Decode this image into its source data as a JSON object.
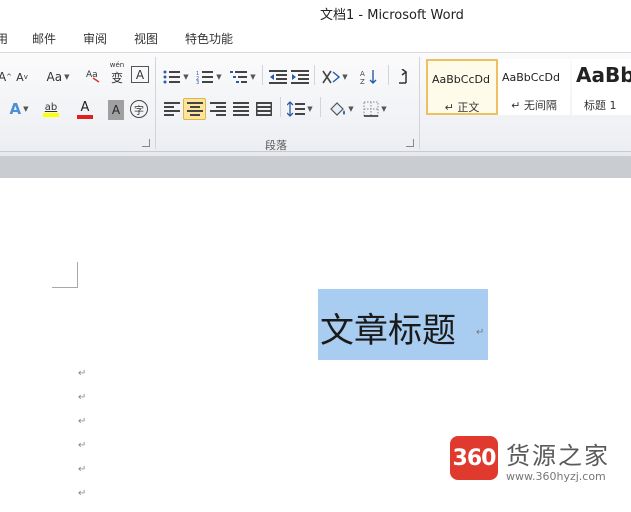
{
  "window": {
    "title": "文档1 - Microsoft Word"
  },
  "menu": {
    "tabs": [
      "用",
      "邮件",
      "审阅",
      "视图",
      "特色功能"
    ]
  },
  "ribbon": {
    "font_group": {
      "grow_font": "A",
      "shrink_font": "A",
      "change_case": "Aa",
      "phonetic": "wén",
      "phonetic_char": "变",
      "char_border": "A",
      "font_color_letter": "A",
      "char_shading": "A",
      "enclose_char": "字",
      "highlight": "ab"
    },
    "paragraph_group": {
      "label": "段落"
    },
    "styles": [
      {
        "sample": "AaBbCcDd",
        "name": "↵ 正文",
        "selected": true
      },
      {
        "sample": "AaBbCcDd",
        "name": "↵ 无间隔",
        "selected": false
      },
      {
        "sample": "AaBb",
        "name": "标题 1",
        "selected": false
      }
    ]
  },
  "document": {
    "title_text": "文章标题",
    "paragraph_mark": "↵",
    "empty_paragraph_count": 6
  },
  "watermark": {
    "badge": "360",
    "name": "货源之家",
    "url": "www.360hyzj.com"
  },
  "colors": {
    "selection": "#a9ccf1",
    "font_color_bar": "#e02020",
    "highlight_bar": "#ffff00",
    "watermark_red": "#e03a2e"
  }
}
